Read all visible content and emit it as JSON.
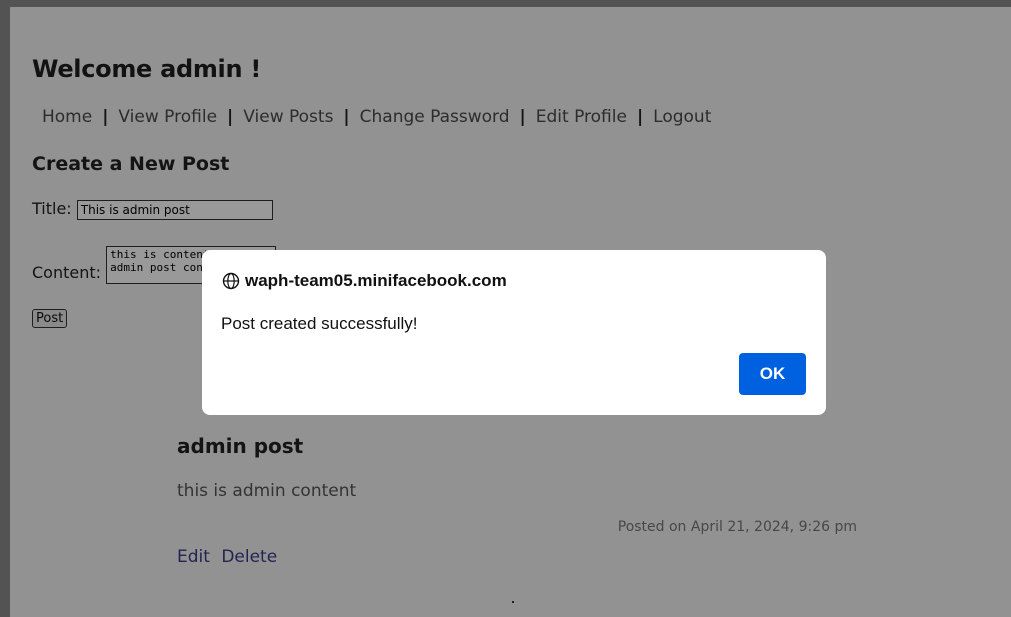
{
  "welcome": "Welcome admin !",
  "nav": {
    "items": [
      "Home",
      "View Profile",
      "View Posts",
      "Change Password",
      "Edit Profile",
      "Logout"
    ],
    "separator": "|"
  },
  "create": {
    "heading": "Create a New Post",
    "title_label": "Title:",
    "title_value": "This is admin post",
    "content_label": "Content:",
    "content_value": "this is content for admin post content",
    "post_button": "Post"
  },
  "post": {
    "title": "admin post",
    "body": "this is admin content",
    "meta": "Posted on April 21, 2024, 9:26 pm",
    "edit_label": "Edit",
    "delete_label": "Delete"
  },
  "dialog": {
    "origin": "waph-team05.minifacebook.com",
    "message": "Post created successfully!",
    "ok_label": "OK",
    "ok_color": "#0061e0"
  }
}
